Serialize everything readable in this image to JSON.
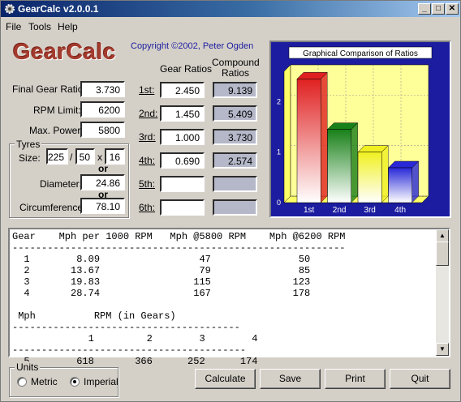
{
  "window": {
    "title": "GearCalc  v2.0.0.1"
  },
  "menu": [
    "File",
    "Tools",
    "Help"
  ],
  "logo": "GearCalc",
  "copyright": "Copyright ©2002, Peter Ogden",
  "left": {
    "final_gear_ratio": {
      "label": "Final Gear Ratio:",
      "value": "3.730"
    },
    "rpm_limit": {
      "label": "RPM Limit:",
      "value": "6200"
    },
    "max_power": {
      "label": "Max. Power:",
      "value": "5800"
    }
  },
  "tyres": {
    "legend": "Tyres",
    "size_label": "Size:",
    "width": "225",
    "slash": "/",
    "profile": "50",
    "x": "x",
    "rim": "16",
    "or1": "or",
    "diameter_label": "Diameter:",
    "diameter": "24.86",
    "or2": "or",
    "circumference_label": "Circumference:",
    "circumference": "78.10"
  },
  "gears": {
    "header_ratios": "Gear Ratios",
    "header_compound": "Compound Ratios",
    "rows": [
      {
        "label": "1st:",
        "ratio": "2.450",
        "compound": "9.139"
      },
      {
        "label": "2nd:",
        "ratio": "1.450",
        "compound": "5.409"
      },
      {
        "label": "3rd:",
        "ratio": "1.000",
        "compound": "3.730"
      },
      {
        "label": "4th:",
        "ratio": "0.690",
        "compound": "2.574"
      },
      {
        "label": "5th:",
        "ratio": "",
        "compound": ""
      },
      {
        "label": "6th:",
        "ratio": "",
        "compound": ""
      }
    ]
  },
  "chart_data": {
    "type": "bar",
    "title": "Graphical Comparison of Ratios",
    "categories": [
      "1st",
      "2nd",
      "3rd",
      "4th"
    ],
    "values": [
      2.45,
      1.45,
      1.0,
      0.69
    ],
    "ylim": [
      0,
      2.6
    ],
    "yticks": [
      "0",
      "1",
      "2"
    ],
    "colors": [
      "#e02020",
      "#188018",
      "#f0f020",
      "#2828d8"
    ],
    "grid": true,
    "background": "#1c1ca0",
    "wall": "#ffff99"
  },
  "output_text": "Gear    Mph per 1000 RPM   Mph @5800 RPM    Mph @6200 RPM\n---------------------------------------------------------\n  1        8.09                 47               50\n  2       13.67                 79               85\n  3       19.83                115              123\n  4       28.74                167              178\n\n Mph          RPM (in Gears)\n---------------------------------------\n             1         2        3        4\n----------------------------------------\n  5        618       366      252      174",
  "units": {
    "legend": "Units",
    "metric": "Metric",
    "imperial": "Imperial",
    "selected": "Imperial"
  },
  "buttons": {
    "calculate": "Calculate",
    "save": "Save",
    "print": "Print",
    "quit": "Quit"
  }
}
